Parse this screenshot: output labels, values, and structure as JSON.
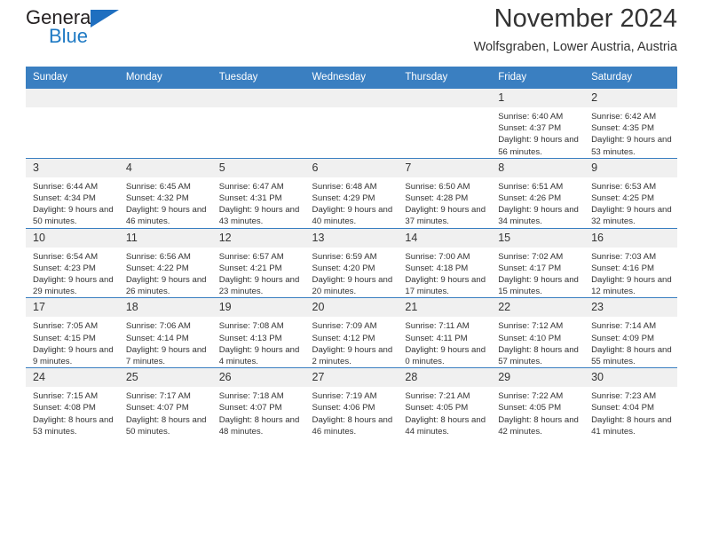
{
  "logo": {
    "word_top": "General",
    "word_bottom": "Blue",
    "triangle_icon": "blue-triangle-icon"
  },
  "header": {
    "title": "November 2024",
    "subtitle": "Wolfsgraben, Lower Austria, Austria"
  },
  "calendar": {
    "weekday_headers": [
      "Sunday",
      "Monday",
      "Tuesday",
      "Wednesday",
      "Thursday",
      "Friday",
      "Saturday"
    ],
    "accent_color": "#3a7fc1",
    "daynum_band_color": "#f0f0f0",
    "weeks": [
      [
        {
          "day": "",
          "sunrise": "",
          "sunset": "",
          "daylight": ""
        },
        {
          "day": "",
          "sunrise": "",
          "sunset": "",
          "daylight": ""
        },
        {
          "day": "",
          "sunrise": "",
          "sunset": "",
          "daylight": ""
        },
        {
          "day": "",
          "sunrise": "",
          "sunset": "",
          "daylight": ""
        },
        {
          "day": "",
          "sunrise": "",
          "sunset": "",
          "daylight": ""
        },
        {
          "day": "1",
          "sunrise": "Sunrise: 6:40 AM",
          "sunset": "Sunset: 4:37 PM",
          "daylight": "Daylight: 9 hours and 56 minutes."
        },
        {
          "day": "2",
          "sunrise": "Sunrise: 6:42 AM",
          "sunset": "Sunset: 4:35 PM",
          "daylight": "Daylight: 9 hours and 53 minutes."
        }
      ],
      [
        {
          "day": "3",
          "sunrise": "Sunrise: 6:44 AM",
          "sunset": "Sunset: 4:34 PM",
          "daylight": "Daylight: 9 hours and 50 minutes."
        },
        {
          "day": "4",
          "sunrise": "Sunrise: 6:45 AM",
          "sunset": "Sunset: 4:32 PM",
          "daylight": "Daylight: 9 hours and 46 minutes."
        },
        {
          "day": "5",
          "sunrise": "Sunrise: 6:47 AM",
          "sunset": "Sunset: 4:31 PM",
          "daylight": "Daylight: 9 hours and 43 minutes."
        },
        {
          "day": "6",
          "sunrise": "Sunrise: 6:48 AM",
          "sunset": "Sunset: 4:29 PM",
          "daylight": "Daylight: 9 hours and 40 minutes."
        },
        {
          "day": "7",
          "sunrise": "Sunrise: 6:50 AM",
          "sunset": "Sunset: 4:28 PM",
          "daylight": "Daylight: 9 hours and 37 minutes."
        },
        {
          "day": "8",
          "sunrise": "Sunrise: 6:51 AM",
          "sunset": "Sunset: 4:26 PM",
          "daylight": "Daylight: 9 hours and 34 minutes."
        },
        {
          "day": "9",
          "sunrise": "Sunrise: 6:53 AM",
          "sunset": "Sunset: 4:25 PM",
          "daylight": "Daylight: 9 hours and 32 minutes."
        }
      ],
      [
        {
          "day": "10",
          "sunrise": "Sunrise: 6:54 AM",
          "sunset": "Sunset: 4:23 PM",
          "daylight": "Daylight: 9 hours and 29 minutes."
        },
        {
          "day": "11",
          "sunrise": "Sunrise: 6:56 AM",
          "sunset": "Sunset: 4:22 PM",
          "daylight": "Daylight: 9 hours and 26 minutes."
        },
        {
          "day": "12",
          "sunrise": "Sunrise: 6:57 AM",
          "sunset": "Sunset: 4:21 PM",
          "daylight": "Daylight: 9 hours and 23 minutes."
        },
        {
          "day": "13",
          "sunrise": "Sunrise: 6:59 AM",
          "sunset": "Sunset: 4:20 PM",
          "daylight": "Daylight: 9 hours and 20 minutes."
        },
        {
          "day": "14",
          "sunrise": "Sunrise: 7:00 AM",
          "sunset": "Sunset: 4:18 PM",
          "daylight": "Daylight: 9 hours and 17 minutes."
        },
        {
          "day": "15",
          "sunrise": "Sunrise: 7:02 AM",
          "sunset": "Sunset: 4:17 PM",
          "daylight": "Daylight: 9 hours and 15 minutes."
        },
        {
          "day": "16",
          "sunrise": "Sunrise: 7:03 AM",
          "sunset": "Sunset: 4:16 PM",
          "daylight": "Daylight: 9 hours and 12 minutes."
        }
      ],
      [
        {
          "day": "17",
          "sunrise": "Sunrise: 7:05 AM",
          "sunset": "Sunset: 4:15 PM",
          "daylight": "Daylight: 9 hours and 9 minutes."
        },
        {
          "day": "18",
          "sunrise": "Sunrise: 7:06 AM",
          "sunset": "Sunset: 4:14 PM",
          "daylight": "Daylight: 9 hours and 7 minutes."
        },
        {
          "day": "19",
          "sunrise": "Sunrise: 7:08 AM",
          "sunset": "Sunset: 4:13 PM",
          "daylight": "Daylight: 9 hours and 4 minutes."
        },
        {
          "day": "20",
          "sunrise": "Sunrise: 7:09 AM",
          "sunset": "Sunset: 4:12 PM",
          "daylight": "Daylight: 9 hours and 2 minutes."
        },
        {
          "day": "21",
          "sunrise": "Sunrise: 7:11 AM",
          "sunset": "Sunset: 4:11 PM",
          "daylight": "Daylight: 9 hours and 0 minutes."
        },
        {
          "day": "22",
          "sunrise": "Sunrise: 7:12 AM",
          "sunset": "Sunset: 4:10 PM",
          "daylight": "Daylight: 8 hours and 57 minutes."
        },
        {
          "day": "23",
          "sunrise": "Sunrise: 7:14 AM",
          "sunset": "Sunset: 4:09 PM",
          "daylight": "Daylight: 8 hours and 55 minutes."
        }
      ],
      [
        {
          "day": "24",
          "sunrise": "Sunrise: 7:15 AM",
          "sunset": "Sunset: 4:08 PM",
          "daylight": "Daylight: 8 hours and 53 minutes."
        },
        {
          "day": "25",
          "sunrise": "Sunrise: 7:17 AM",
          "sunset": "Sunset: 4:07 PM",
          "daylight": "Daylight: 8 hours and 50 minutes."
        },
        {
          "day": "26",
          "sunrise": "Sunrise: 7:18 AM",
          "sunset": "Sunset: 4:07 PM",
          "daylight": "Daylight: 8 hours and 48 minutes."
        },
        {
          "day": "27",
          "sunrise": "Sunrise: 7:19 AM",
          "sunset": "Sunset: 4:06 PM",
          "daylight": "Daylight: 8 hours and 46 minutes."
        },
        {
          "day": "28",
          "sunrise": "Sunrise: 7:21 AM",
          "sunset": "Sunset: 4:05 PM",
          "daylight": "Daylight: 8 hours and 44 minutes."
        },
        {
          "day": "29",
          "sunrise": "Sunrise: 7:22 AM",
          "sunset": "Sunset: 4:05 PM",
          "daylight": "Daylight: 8 hours and 42 minutes."
        },
        {
          "day": "30",
          "sunrise": "Sunrise: 7:23 AM",
          "sunset": "Sunset: 4:04 PM",
          "daylight": "Daylight: 8 hours and 41 minutes."
        }
      ]
    ]
  }
}
